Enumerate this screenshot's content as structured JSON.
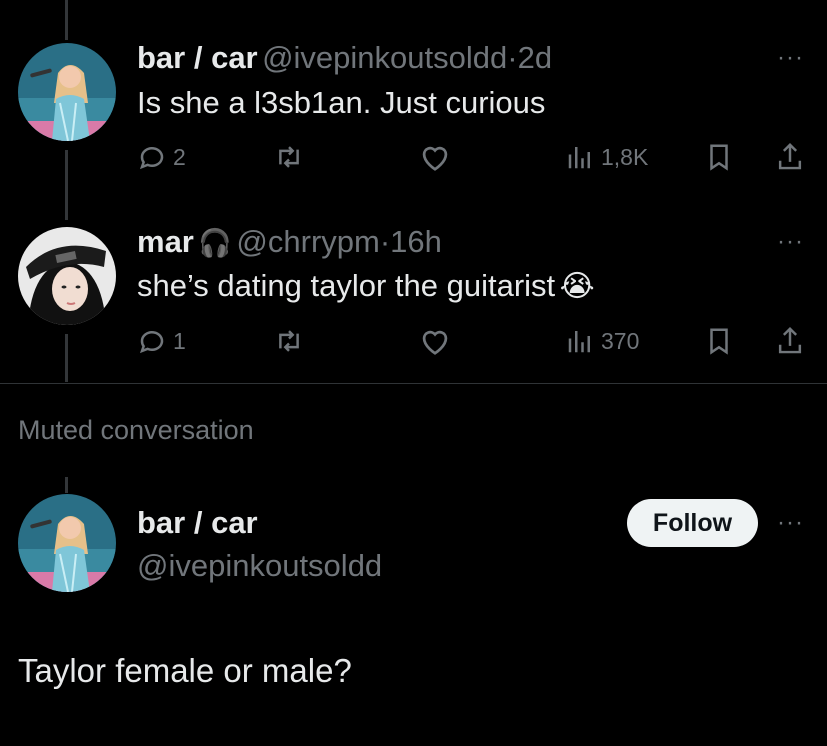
{
  "tweets": [
    {
      "name": "bar / car",
      "handle": "@ivepinkoutsoldd",
      "separator": "·",
      "time": "2d",
      "text": "Is she a l3sb1an. Just curious",
      "replies": "2",
      "views": "1,8K"
    },
    {
      "name": "mar",
      "name_emoji": "🎧",
      "handle": "@chrrypm",
      "separator": "·",
      "time": "16h",
      "text": "she’s dating taylor the guitarist",
      "text_emoji": "😭",
      "replies": "1",
      "views": "370"
    }
  ],
  "muted": {
    "label": "Muted conversation"
  },
  "main_post": {
    "name": "bar / car",
    "handle": "@ivepinkoutsoldd",
    "follow_label": "Follow",
    "text": "Taylor female or male?"
  },
  "more_glyph": "···",
  "colors": {
    "background": "#000000",
    "text": "#e7e9ea",
    "muted_text": "#71767b",
    "divider": "#2f3336",
    "button_bg": "#eff3f4"
  },
  "icons": [
    "reply-icon",
    "retweet-icon",
    "like-icon",
    "views-icon",
    "bookmark-icon",
    "share-icon",
    "headphones-emoji",
    "crying-face-emoji",
    "more-icon"
  ]
}
